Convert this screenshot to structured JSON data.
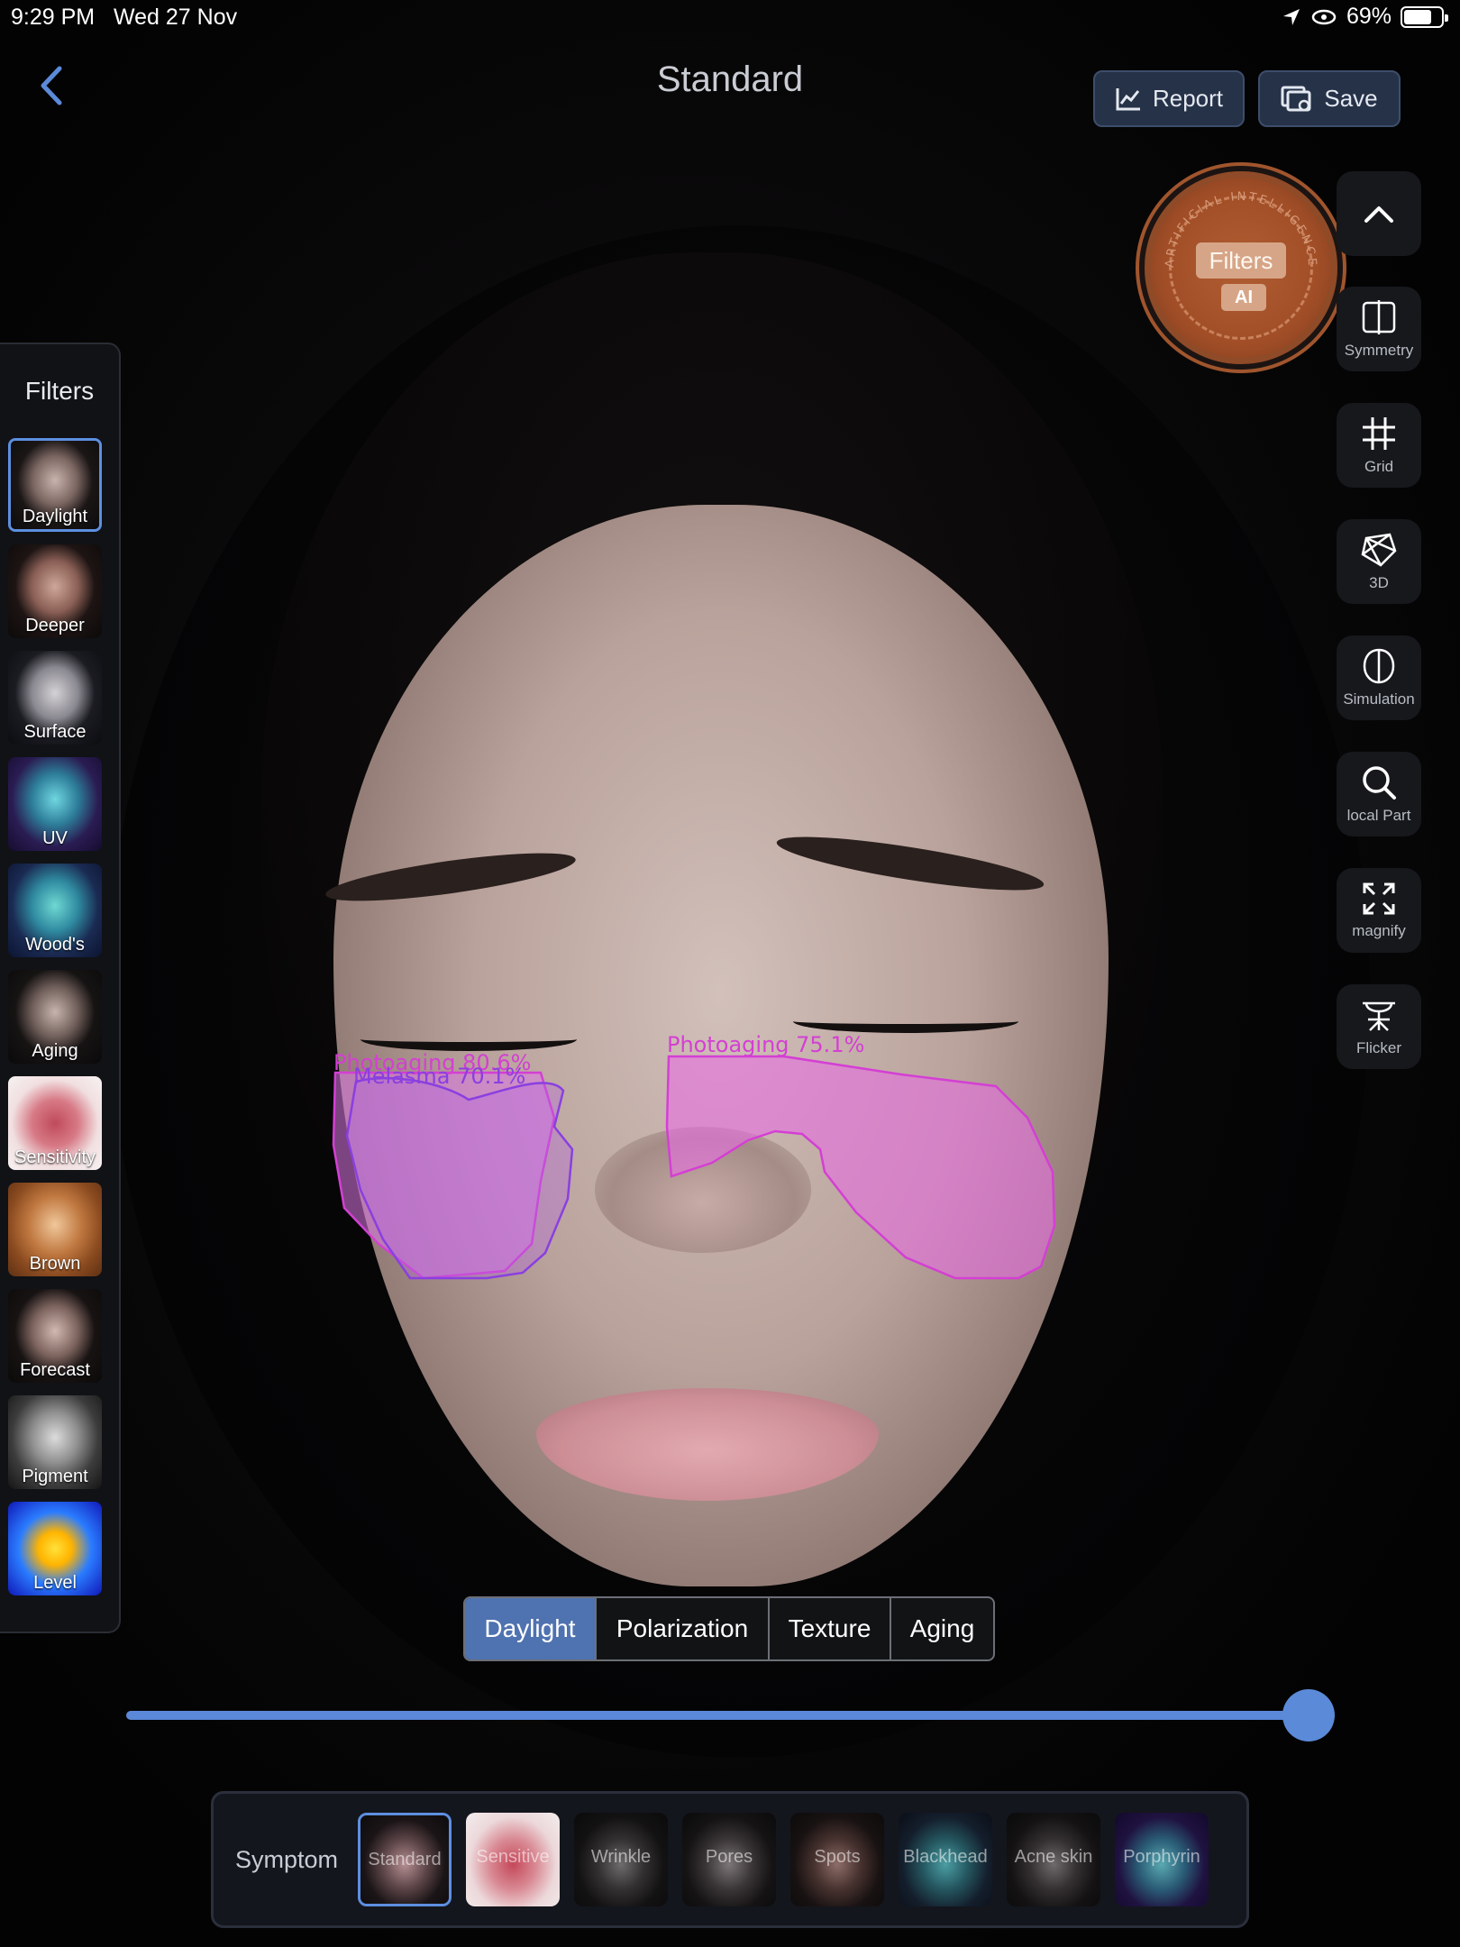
{
  "status_bar": {
    "time": "9:29 PM",
    "date": "Wed 27 Nov",
    "battery": "69%",
    "battery_level": 0.69
  },
  "header": {
    "title": "Standard",
    "report_label": "Report",
    "save_label": "Save"
  },
  "ai_badge": {
    "label": "Filters",
    "sub": "AI",
    "ring_text": "ARTIFICIAL INTELLIGENCE"
  },
  "tools": {
    "collapse_icon": "chevron-up-icon",
    "items": [
      {
        "label": "Symmetry",
        "icon": "symmetry-icon"
      },
      {
        "label": "Grid",
        "icon": "grid-icon"
      },
      {
        "label": "3D",
        "icon": "3d-icon"
      },
      {
        "label": "Simulation",
        "icon": "simulation-icon"
      },
      {
        "label": "local Part",
        "icon": "search-icon"
      },
      {
        "label": "magnify",
        "icon": "expand-icon"
      },
      {
        "label": "Flicker",
        "icon": "flicker-icon"
      }
    ]
  },
  "filters": {
    "title": "Filters",
    "selected": "Daylight",
    "items": [
      {
        "label": "Daylight"
      },
      {
        "label": "Deeper"
      },
      {
        "label": "Surface"
      },
      {
        "label": "UV"
      },
      {
        "label": "Wood's"
      },
      {
        "label": "Aging"
      },
      {
        "label": "Sensitivity"
      },
      {
        "label": "Brown"
      },
      {
        "label": "Forecast"
      },
      {
        "label": "Pigment"
      },
      {
        "label": "Level"
      }
    ]
  },
  "annotations": [
    {
      "label": "Photoaging 80.6%",
      "color": "#d43fd4"
    },
    {
      "label": "Melasma 70.1%",
      "color": "#8a3fe0"
    },
    {
      "label": "Photoaging 75.1%",
      "color": "#d43fd4"
    }
  ],
  "modes": {
    "selected": "Daylight",
    "items": [
      "Daylight",
      "Polarization",
      "Texture",
      "Aging"
    ]
  },
  "slider": {
    "value": 1.0
  },
  "symptom": {
    "label": "Symptom",
    "selected": "Standard",
    "items": [
      "Standard",
      "Sensitive",
      "Wrinkle",
      "Pores",
      "Spots",
      "Blackhead",
      "Acne skin",
      "Porphyrin"
    ]
  },
  "colors": {
    "accent": "#5b8ad8",
    "panel": "#101216",
    "photoaging": "#d43fd4",
    "melasma": "#8a3fe0"
  }
}
